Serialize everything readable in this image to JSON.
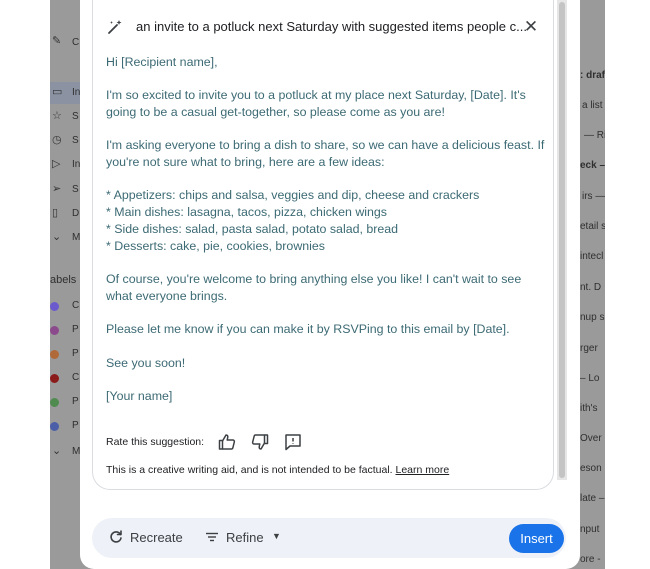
{
  "prompt": {
    "icon": "wand-icon",
    "text": "an invite to a potluck next Saturday with suggested items people c...",
    "close_icon": "close-icon"
  },
  "body": {
    "greeting": "Hi [Recipient name],",
    "para1": "I'm so excited to invite you to a potluck at my place next Saturday, [Date]. It's going to be a casual get-together, so please come as you are!",
    "para2": "I'm asking everyone to bring a dish to share, so we can have a delicious feast. If you're not sure what to bring, here are a few ideas:",
    "list": [
      "* Appetizers: chips and salsa, veggies and dip, cheese and crackers",
      "* Main dishes: lasagna, tacos, pizza, chicken wings",
      "* Side dishes: salad, pasta salad, potato salad, bread",
      "* Desserts: cake, pie, cookies, brownies"
    ],
    "para3": "Of course, you're welcome to bring anything else you like! I can't wait to see what everyone brings.",
    "para4": "Please let me know if you can make it by RSVPing to this email by [Date].",
    "closing": "See you soon!",
    "signature": "[Your name]"
  },
  "rating": {
    "label": "Rate this suggestion:",
    "icons": [
      "thumbs-up-icon",
      "thumbs-down-icon",
      "report-icon"
    ]
  },
  "disclaimer": {
    "text": "This is a creative writing aid, and is not intended to be factual. ",
    "link": "Learn more"
  },
  "footer": {
    "recreate_label": "Recreate",
    "refine_label": "Refine",
    "insert_label": "Insert"
  },
  "background": {
    "left_labels": [
      "C",
      "In",
      "S",
      "S",
      "In",
      "S",
      "D",
      "M",
      "abels",
      "C",
      "P",
      "P",
      "C",
      "P",
      "P",
      "M"
    ],
    "right_labels": [
      ": draf",
      "a list",
      "— Ri",
      "eck –",
      "irs —",
      "etail s",
      "intecl",
      "nt. D",
      "nup s",
      "rger",
      "– Lo",
      "ith's",
      "Over",
      "eson",
      "late –",
      "nput",
      "ore -"
    ],
    "label_colors": [
      "#6a5acd",
      "#c0504d",
      "#a0522d",
      "#8b1a1a",
      "#4f8a4f",
      "#4a5fa8"
    ]
  },
  "colors": {
    "body_text": "#3c6a74",
    "accent": "#1a73e8",
    "footer_bg": "#eef1f7"
  }
}
